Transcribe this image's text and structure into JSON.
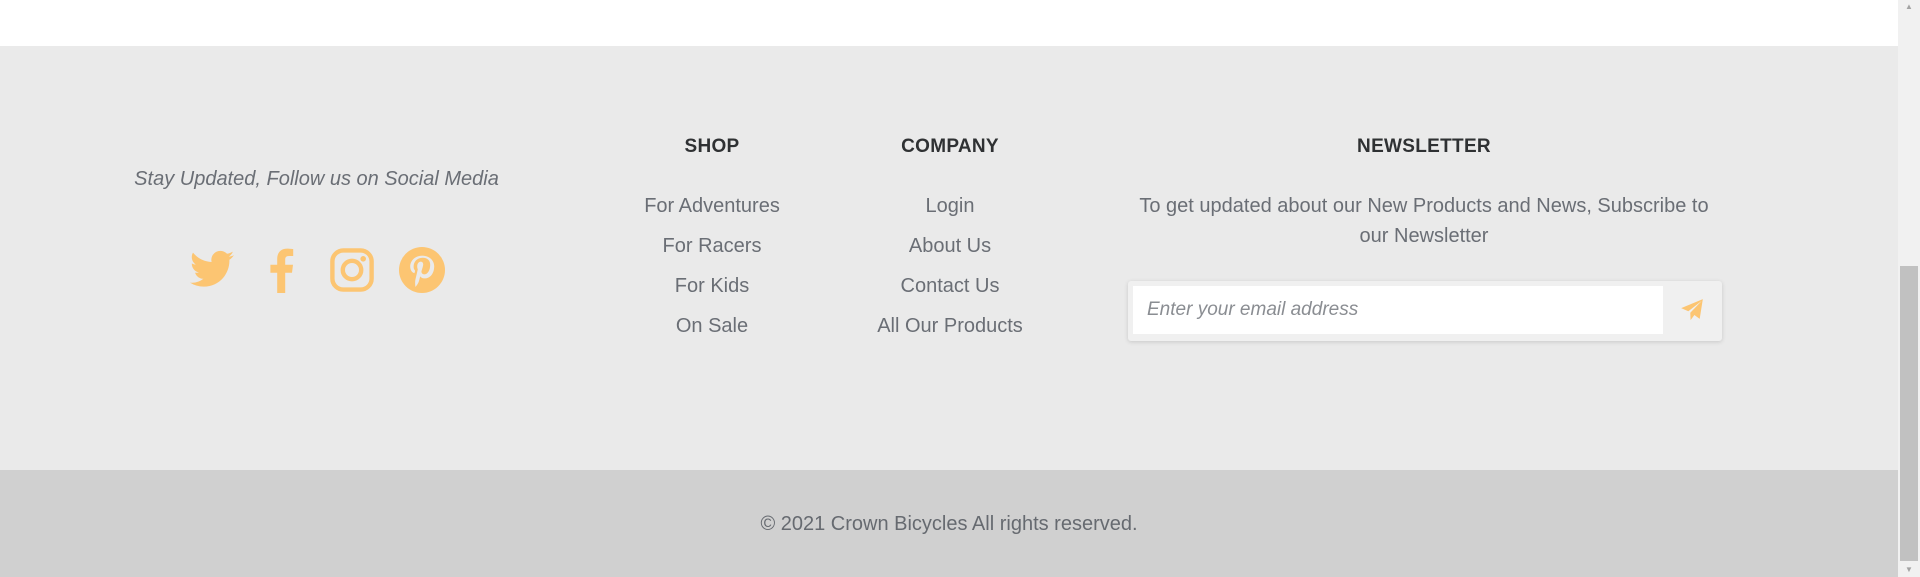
{
  "colors": {
    "accent": "#fcc572",
    "footer_bg": "#eaeaea",
    "bottom_bar_bg": "#d0d0d0",
    "text_muted": "#6a6e75",
    "heading": "#2f3133"
  },
  "social": {
    "tagline": "Stay Updated, Follow us on Social Media",
    "icons": [
      "twitter-icon",
      "facebook-icon",
      "instagram-icon",
      "pinterest-icon"
    ]
  },
  "shop": {
    "heading": "SHOP",
    "items": [
      "For Adventures",
      "For Racers",
      "For Kids",
      "On Sale"
    ]
  },
  "company": {
    "heading": "COMPANY",
    "items": [
      "Login",
      "About Us",
      "Contact Us",
      "All Our Products"
    ]
  },
  "newsletter": {
    "heading": "NEWSLETTER",
    "text": "To get updated about our New Products and News, Subscribe to our Newsletter",
    "placeholder": "Enter your email address",
    "submit_icon": "paper-plane-icon"
  },
  "footer": {
    "copyright": "© 2021 Crown Bicycles All rights reserved."
  },
  "scrollbar": {
    "up_arrow": "▲",
    "down_arrow": "▼"
  }
}
